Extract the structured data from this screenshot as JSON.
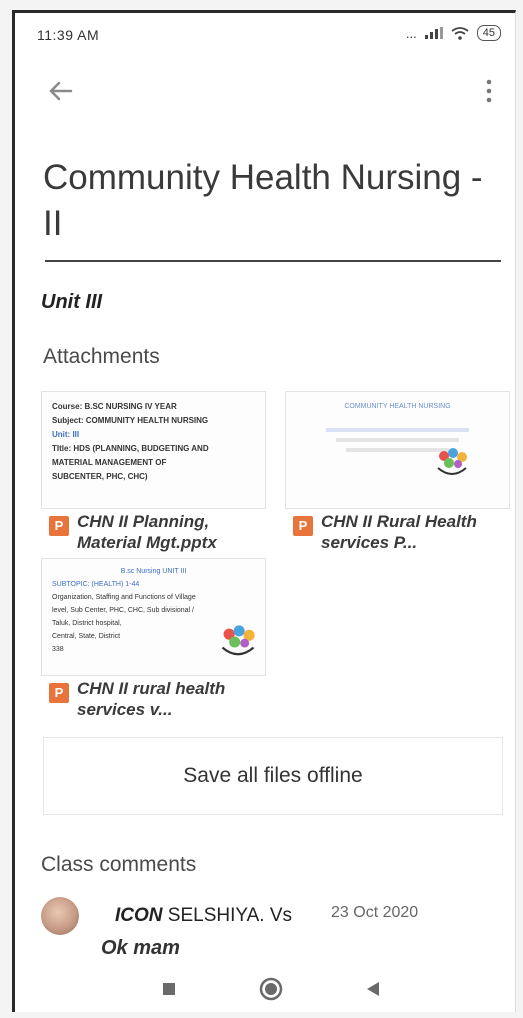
{
  "status": {
    "time": "11:39 AM",
    "icons": "...",
    "battery": "45"
  },
  "topbar": {
    "back_icon": "arrow-left-icon",
    "more_icon": "more-vert-icon"
  },
  "title": "Community Health Nursing - II",
  "description": "Unit III",
  "attachments": {
    "heading": "Attachments",
    "items": [
      {
        "name": "CHN II Planning, Material Mgt.pptx",
        "type_letter": "P",
        "thumb_lines": [
          "Course: B.SC NURSING IV YEAR",
          "Subject: COMMUNITY HEALTH NURSING",
          "Unit: III",
          "TItle: HDS (PLANNING, BUDGETING AND",
          "MATERIAL MANAGEMENT OF",
          "SUBCENTER, PHC, CHC)"
        ]
      },
      {
        "name": "CHN II Rural Health  services P...",
        "type_letter": "P",
        "thumb_lines": [
          "COMMUNITY HEALTH NURSING"
        ]
      },
      {
        "name": "CHN II rural health services  v...",
        "type_letter": "P",
        "thumb_lines": [
          "B.sc Nursing UNIT III",
          "SUBTOPIC: (HEALTH) 1-44",
          "Organization, Staffing and Functions of Village",
          "level, Sub Center, PHC, CHC, Sub divisional /",
          "Taluk,  District hospital,",
          "Central, State, District",
          "338"
        ]
      }
    ]
  },
  "save_offline_label": "Save all files offline",
  "comments": {
    "heading": "Class comments",
    "items": [
      {
        "author_prefix": "ICON",
        "author": "SELSHIYA. Vs",
        "date": "23 Oct 2020",
        "text": "Ok mam"
      }
    ]
  },
  "navbar": {
    "recents_icon": "square-icon",
    "home_icon": "circle-icon",
    "back_icon": "triangle-back-icon"
  }
}
